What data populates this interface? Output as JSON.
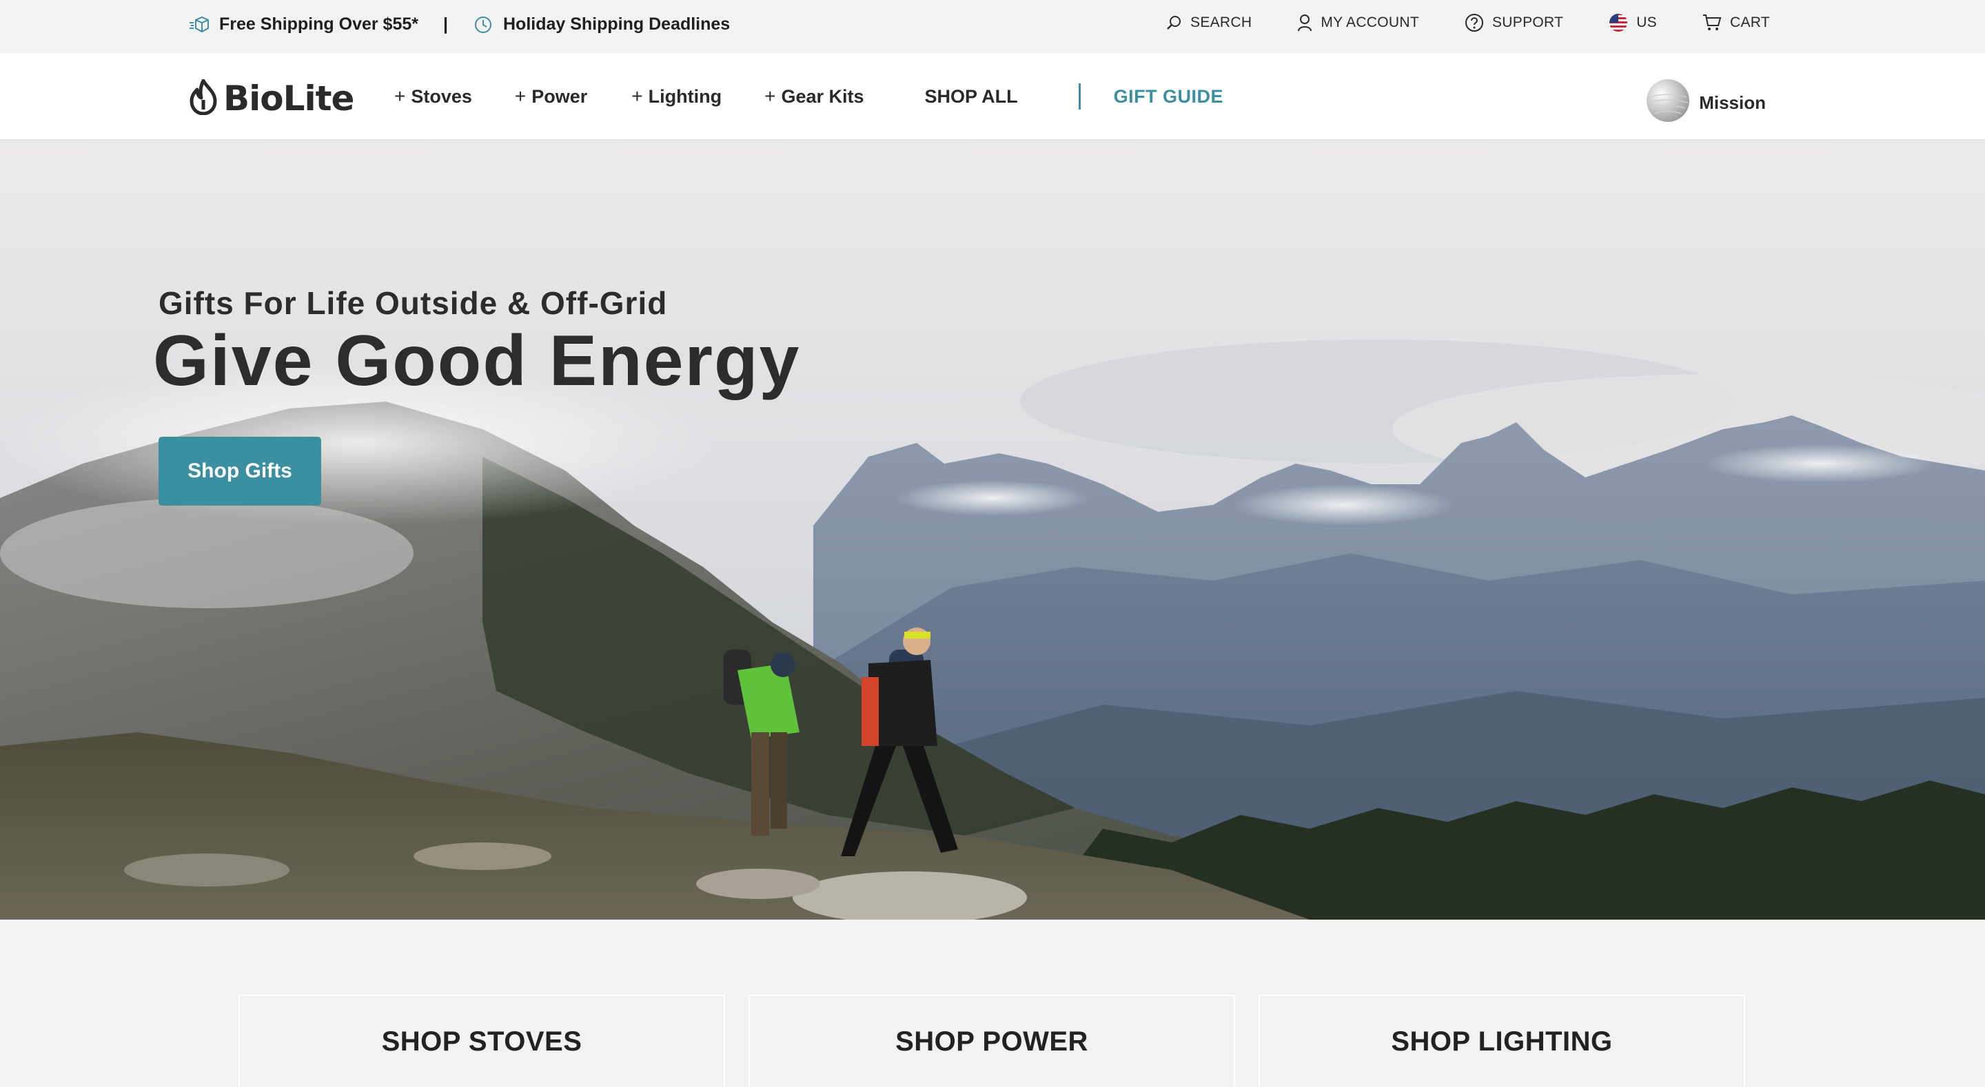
{
  "utility_bar": {
    "shipping_promo": "Free Shipping Over $55*",
    "separator": "|",
    "holiday_link": "Holiday Shipping Deadlines",
    "links": [
      {
        "label": "SEARCH",
        "icon": "search-icon"
      },
      {
        "label": "MY ACCOUNT",
        "icon": "user-icon"
      },
      {
        "label": "SUPPORT",
        "icon": "help-circle-icon"
      },
      {
        "label": "US",
        "icon": "us-flag-icon"
      },
      {
        "label": "CART",
        "icon": "cart-icon"
      }
    ]
  },
  "nav": {
    "logo": "BioLite",
    "items": [
      {
        "label": "Stoves",
        "prefix": "+"
      },
      {
        "label": "Power",
        "prefix": "+"
      },
      {
        "label": "Lighting",
        "prefix": "+"
      },
      {
        "label": "Gear Kits",
        "prefix": "+"
      },
      {
        "label": "SHOP ALL",
        "prefix": ""
      }
    ],
    "gift_guide": "GIFT GUIDE",
    "mission": "Mission"
  },
  "hero": {
    "subtitle": "Gifts For Life Outside & Off-Grid",
    "title": "Give Good Energy",
    "cta": "Shop Gifts"
  },
  "categories": [
    {
      "label": "SHOP STOVES"
    },
    {
      "label": "SHOP POWER"
    },
    {
      "label": "SHOP LIGHTING"
    }
  ],
  "colors": {
    "accent": "#3a8fa0",
    "text": "#2a2a2a",
    "bar_bg": "#f2f2f2"
  }
}
